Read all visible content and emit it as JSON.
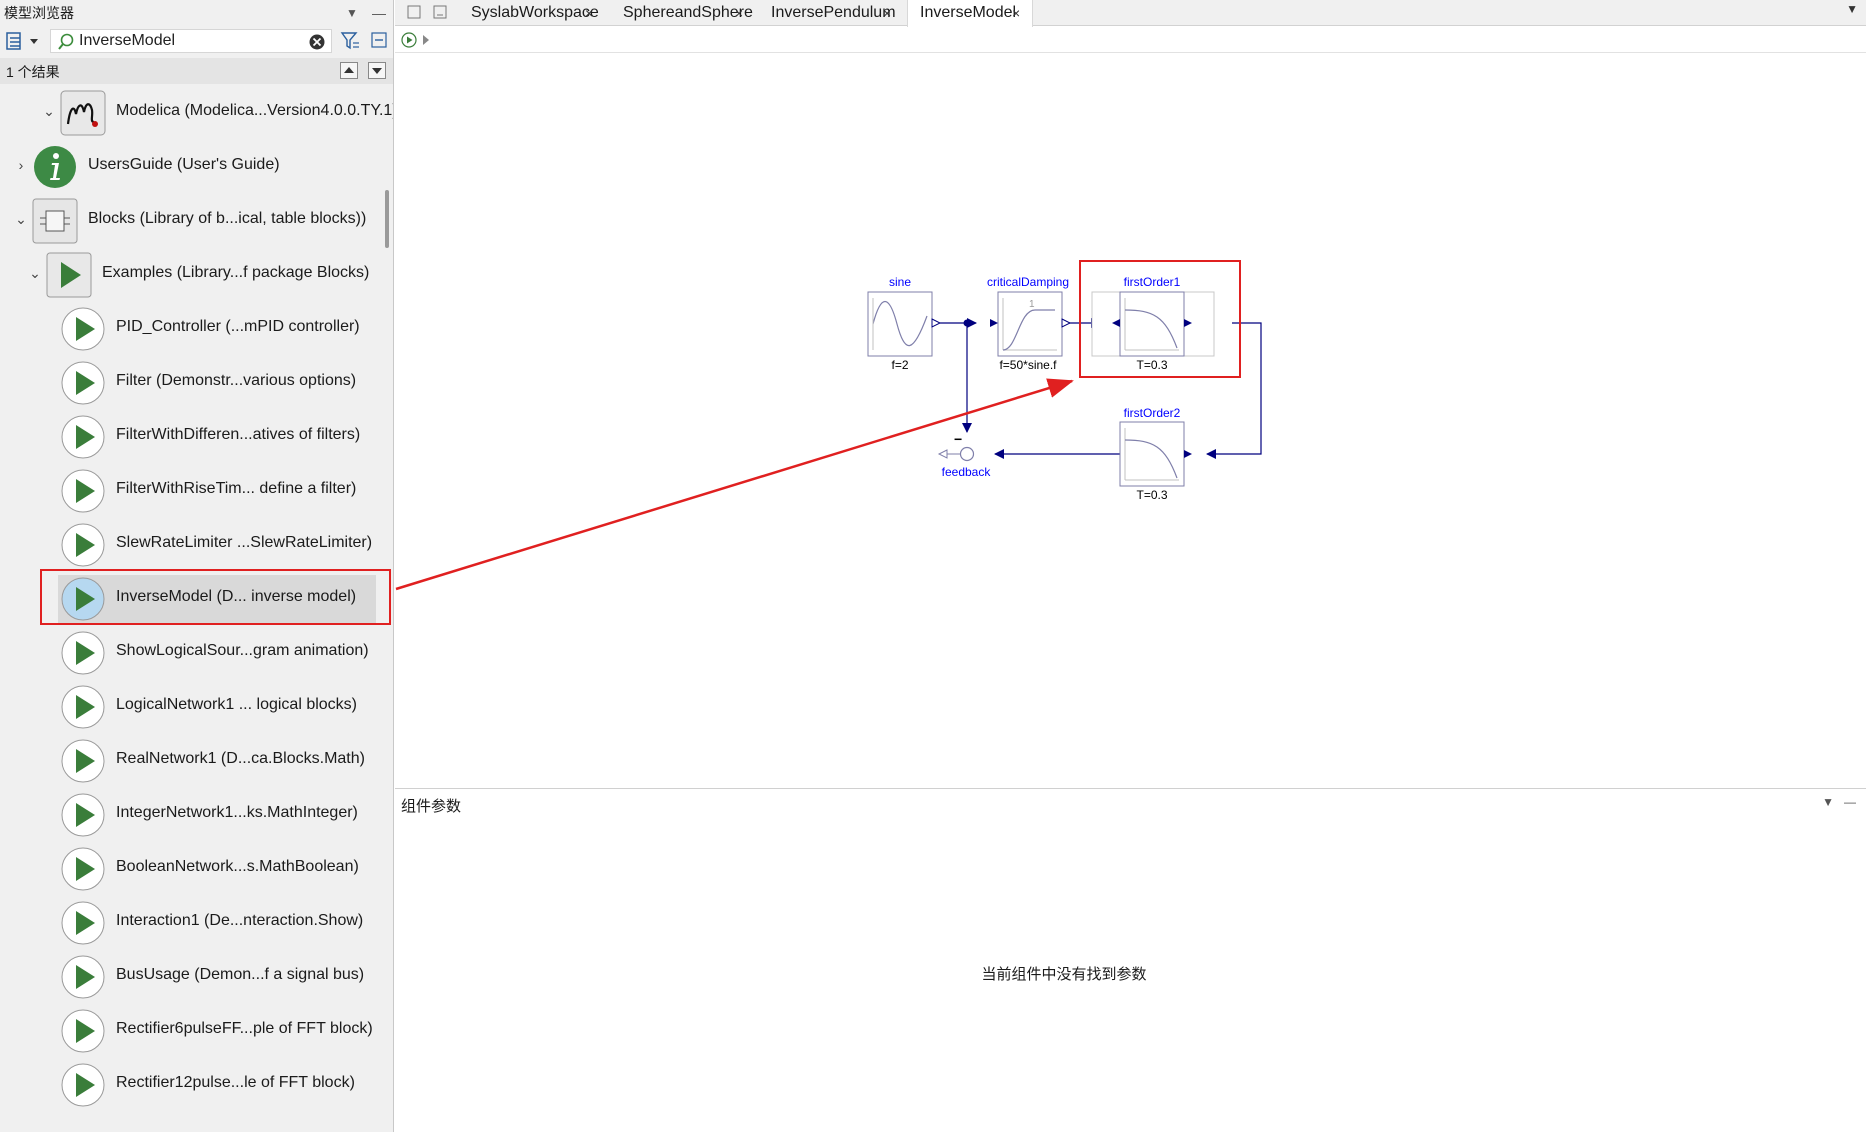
{
  "model_browser": {
    "title": "模型浏览器",
    "search_value": "InverseModel",
    "result_count": "1 个结果"
  },
  "tree": {
    "items": [
      {
        "label": "Modelica (Modelica...Version4.0.0.TY.1)",
        "icon": "modelica-logo-icon",
        "expanded": true
      },
      {
        "label": "UsersGuide (User's Guide)",
        "icon": "info-icon",
        "expanded": false
      },
      {
        "label": "Blocks (Library of b...ical, table blocks))",
        "icon": "blocks-package-icon",
        "expanded": true
      },
      {
        "label": "Examples (Library...f package Blocks)",
        "icon": "examples-play-icon",
        "expanded": true
      },
      {
        "label": "PID_Controller (...mPID controller)",
        "icon": "play-icon"
      },
      {
        "label": "Filter (Demonstr...various options)",
        "icon": "play-icon"
      },
      {
        "label": "FilterWithDifferen...atives of filters)",
        "icon": "play-icon"
      },
      {
        "label": "FilterWithRiseTim... define a filter)",
        "icon": "play-icon"
      },
      {
        "label": "SlewRateLimiter ...SlewRateLimiter)",
        "icon": "play-icon"
      },
      {
        "label": "InverseModel (D... inverse model)",
        "icon": "play-icon",
        "selected": true
      },
      {
        "label": "ShowLogicalSour...gram animation)",
        "icon": "play-icon"
      },
      {
        "label": "LogicalNetwork1 ... logical blocks)",
        "icon": "play-icon"
      },
      {
        "label": "RealNetwork1 (D...ca.Blocks.Math)",
        "icon": "play-icon"
      },
      {
        "label": "IntegerNetwork1...ks.MathInteger)",
        "icon": "play-icon"
      },
      {
        "label": "BooleanNetwork...s.MathBoolean)",
        "icon": "play-icon"
      },
      {
        "label": "Interaction1 (De...nteraction.Show)",
        "icon": "play-icon"
      },
      {
        "label": "BusUsage (Demon...f a signal bus)",
        "icon": "play-icon"
      },
      {
        "label": "Rectifier6pulseFF...ple of FFT block)",
        "icon": "play-icon"
      },
      {
        "label": "Rectifier12pulse...le of FFT block)",
        "icon": "play-icon"
      }
    ]
  },
  "tabs": [
    {
      "label": "SyslabWorkspace",
      "active": false
    },
    {
      "label": "SphereandSphere",
      "active": false
    },
    {
      "label": "InversePendulum",
      "active": false
    },
    {
      "label": "InverseModel",
      "active": true
    }
  ],
  "diagram": {
    "blocks": {
      "sine": {
        "name": "sine",
        "param": "f=2"
      },
      "criticalDamping": {
        "name": "criticalDamping",
        "param": "f=50*sine.f",
        "glyph": "1"
      },
      "firstOrder1": {
        "name": "firstOrder1",
        "param": "T=0.3"
      },
      "firstOrder2": {
        "name": "firstOrder2",
        "param": "T=0.3"
      },
      "feedback": {
        "name": "feedback",
        "sign": "−"
      }
    }
  },
  "params": {
    "title": "组件参数",
    "empty_message": "当前组件中没有找到参数"
  },
  "colors": {
    "accent_red": "#e02020",
    "play_green": "#3a7d3a",
    "connector_blue": "#00007f",
    "label_blue": "#0000ff"
  }
}
